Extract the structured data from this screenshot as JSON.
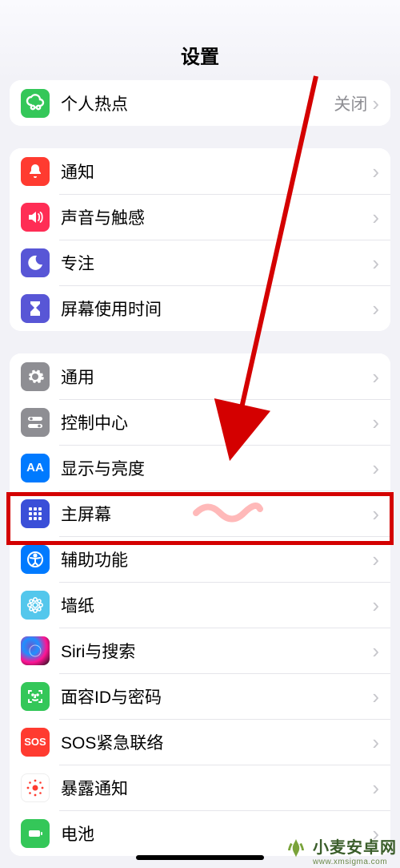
{
  "header": {
    "title": "设置"
  },
  "group0": {
    "hotspot": {
      "label": "个人热点",
      "detail": "关闭"
    }
  },
  "group1": {
    "notifications": {
      "label": "通知"
    },
    "sounds": {
      "label": "声音与触感"
    },
    "focus": {
      "label": "专注"
    },
    "screentime": {
      "label": "屏幕使用时间"
    }
  },
  "group2": {
    "general": {
      "label": "通用"
    },
    "control": {
      "label": "控制中心"
    },
    "display": {
      "label": "显示与亮度"
    },
    "home": {
      "label": "主屏幕"
    },
    "accessibility": {
      "label": "辅助功能"
    },
    "wallpaper": {
      "label": "墙纸"
    },
    "siri": {
      "label": "Siri与搜索"
    },
    "faceid": {
      "label": "面容ID与密码"
    },
    "sos": {
      "label": "SOS紧急联络"
    },
    "exposure": {
      "label": "暴露通知"
    },
    "battery": {
      "label": "电池"
    }
  },
  "icons": {
    "sos_text": "SOS",
    "aa_text": "AA"
  },
  "colors": {
    "hotspot": "#34c759",
    "notifications": "#ff3b30",
    "sounds": "#ff2d55",
    "focus": "#5856d6",
    "screentime": "#5856d6",
    "general": "#8e8e93",
    "control": "#8e8e93",
    "display": "#007aff",
    "home": "#3355dd",
    "accessibility": "#007aff",
    "wallpaper": "#54c7ec",
    "siri": "#222",
    "faceid": "#34c759",
    "sos": "#ff3b30",
    "exposure": "#fff",
    "battery": "#34c759",
    "highlight": "#d40000"
  },
  "watermark": {
    "text": "小麦安卓网",
    "url_hint": "www.xmsigma.com"
  }
}
